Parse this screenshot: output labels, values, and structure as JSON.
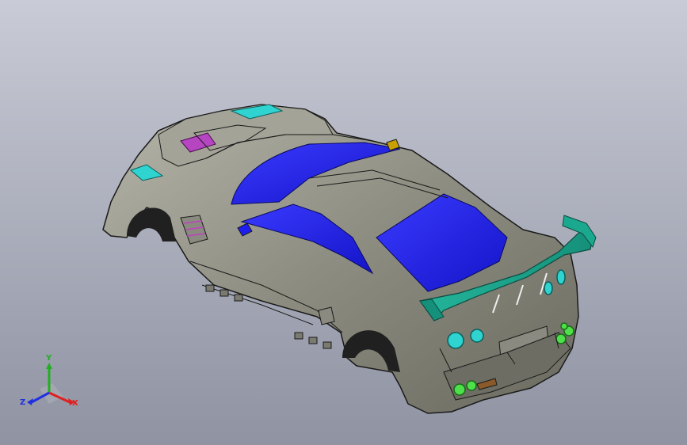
{
  "viewport": {
    "background_top": "#c9cbd6",
    "background_bottom": "#8f93a2",
    "model_colors": {
      "body": "#8b8b80",
      "glass": "#1e1ef0",
      "vents_and_wing": "#1aa88e",
      "lights": "#2fd3d0",
      "exhaust": "#4de04a",
      "intake": "#c040c0"
    }
  },
  "triad": {
    "x_label": "X",
    "y_label": "Y",
    "z_label": "Z",
    "x_color": "#e02020",
    "y_color": "#20b020",
    "z_color": "#2030e0"
  }
}
